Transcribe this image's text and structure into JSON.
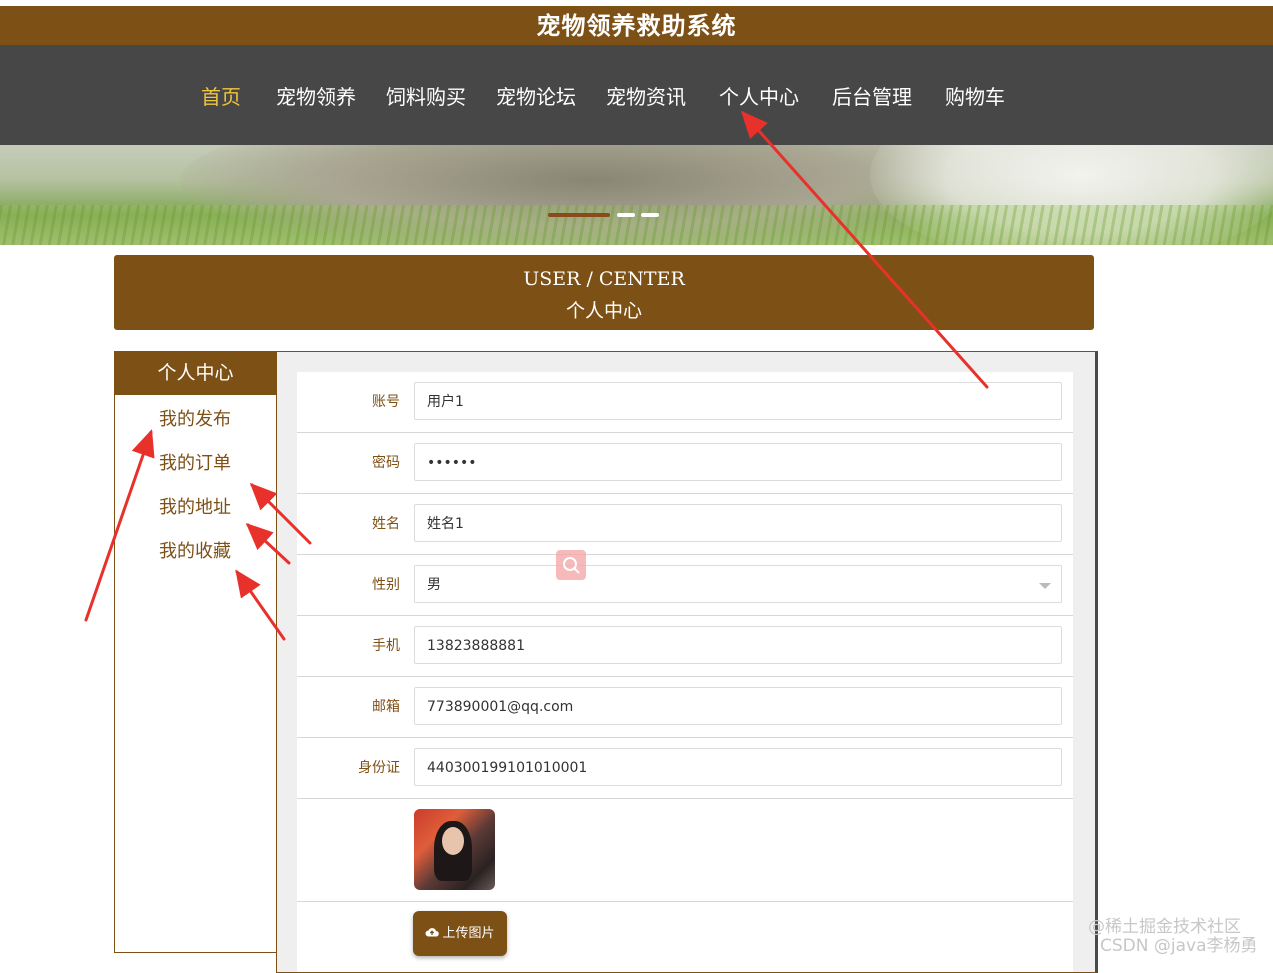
{
  "app": {
    "title": "宠物领养救助系统"
  },
  "nav": {
    "items": [
      {
        "label": "首页",
        "active": true
      },
      {
        "label": "宠物领养"
      },
      {
        "label": "饲料购买"
      },
      {
        "label": "宠物论坛"
      },
      {
        "label": "宠物资讯"
      },
      {
        "label": "个人中心"
      },
      {
        "label": "后台管理"
      },
      {
        "label": "购物车"
      }
    ]
  },
  "section_header": {
    "en": "USER / CENTER",
    "cn": "个人中心"
  },
  "sidebar": {
    "title": "个人中心",
    "items": [
      {
        "label": "我的发布"
      },
      {
        "label": "我的订单"
      },
      {
        "label": "我的地址"
      },
      {
        "label": "我的收藏"
      }
    ]
  },
  "form": {
    "fields": [
      {
        "label": "账号",
        "value": "用户1"
      },
      {
        "label": "密码",
        "value": "••••••"
      },
      {
        "label": "姓名",
        "value": "姓名1"
      },
      {
        "label": "性别",
        "value": "男"
      },
      {
        "label": "手机",
        "value": "13823888881"
      },
      {
        "label": "邮箱",
        "value": "773890001@qq.com"
      },
      {
        "label": "身份证",
        "value": "440300199101010001"
      }
    ],
    "upload_label": "上传图片"
  },
  "watermark": {
    "line1": "@稀土掘金技术社区",
    "line2": "CSDN @java李杨勇"
  },
  "colors": {
    "brand": "#7d5016",
    "nav_bg": "#474747",
    "active": "#f0c43e",
    "annotation": "#e8312b"
  }
}
